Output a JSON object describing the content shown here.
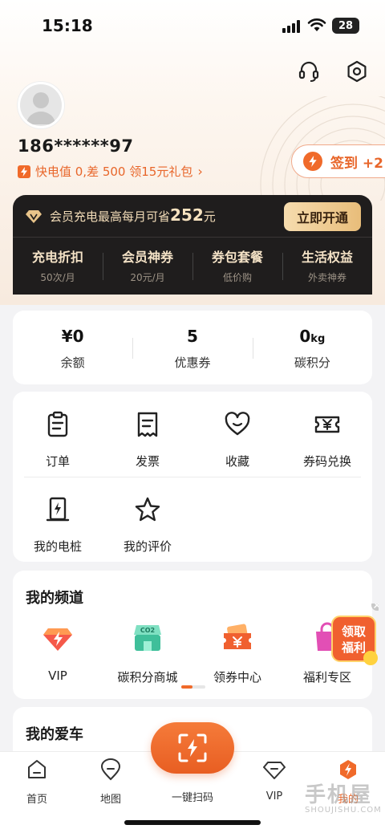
{
  "status": {
    "time": "15:18",
    "battery": "28"
  },
  "profile": {
    "phone": "186******97",
    "elec_promo": "快电值 0,差 500 领15元礼包"
  },
  "checkin": {
    "label": "签到 +2"
  },
  "vip": {
    "promo_prefix": "会员充电最高每月可省",
    "promo_amount": "252",
    "promo_unit": "元",
    "open_button": "立即开通",
    "benefits": [
      {
        "title": "充电折扣",
        "sub": "50次/月"
      },
      {
        "title": "会员神券",
        "sub": "20元/月"
      },
      {
        "title": "券包套餐",
        "sub": "低价购"
      },
      {
        "title": "生活权益",
        "sub": "外卖神券"
      }
    ]
  },
  "stats": [
    {
      "value": "¥0",
      "unit": "",
      "label": "余额"
    },
    {
      "value": "5",
      "unit": "",
      "label": "优惠券"
    },
    {
      "value": "0",
      "unit": "kg",
      "label": "碳积分"
    }
  ],
  "menu": [
    {
      "label": "订单",
      "icon": "clipboard-icon"
    },
    {
      "label": "发票",
      "icon": "receipt-icon"
    },
    {
      "label": "收藏",
      "icon": "heart-icon"
    },
    {
      "label": "券码兑换",
      "icon": "ticket-yen-icon"
    },
    {
      "label": "我的电桩",
      "icon": "charger-pile-icon"
    },
    {
      "label": "我的评价",
      "icon": "star-icon"
    }
  ],
  "channel": {
    "title": "我的频道",
    "items": [
      {
        "label": "VIP",
        "icon": "vip-diamond-icon"
      },
      {
        "label": "碳积分商城",
        "icon": "co2-store-icon"
      },
      {
        "label": "领券中心",
        "icon": "coupon-center-icon"
      },
      {
        "label": "福利专区",
        "icon": "welfare-bag-icon"
      }
    ],
    "badge_line1": "领取",
    "badge_line2": "福利"
  },
  "car": {
    "title": "我的爱车"
  },
  "tabbar": {
    "items": [
      {
        "label": "首页",
        "icon": "home-icon"
      },
      {
        "label": "地图",
        "icon": "map-pin-icon"
      },
      {
        "label": "一键扫码",
        "icon": "scan-icon"
      },
      {
        "label": "VIP",
        "icon": "vip-icon"
      },
      {
        "label": "我的",
        "icon": "profile-bolt-icon"
      }
    ],
    "active": "我的"
  },
  "watermark": {
    "text": "手机屋",
    "sub": "SHOUJISHU.COM"
  },
  "colors": {
    "accent": "#f06a2a",
    "vip_bg": "#1f1d1d",
    "gold": "#f2dcb8"
  }
}
